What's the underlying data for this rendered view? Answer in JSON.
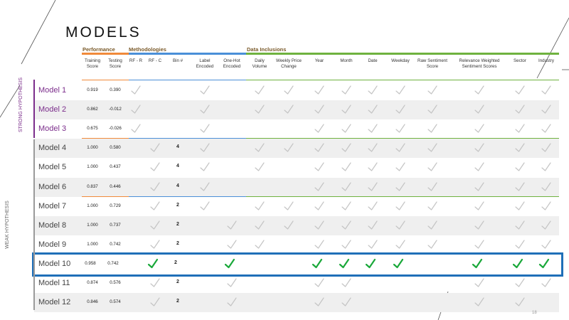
{
  "title": "MODELS",
  "groups": {
    "performance": "Performance",
    "methodologies": "Methodologies",
    "data_inclusions": "Data Inclusions"
  },
  "side_labels": {
    "strong": "STRONG HYPOTHESIS",
    "weak": "WEAK HYPOTHESIS"
  },
  "columns": [
    {
      "key": "train",
      "label": "Training Score"
    },
    {
      "key": "test",
      "label": "Testing Score"
    },
    {
      "key": "rfr",
      "label": "RF - R"
    },
    {
      "key": "rfc",
      "label": "RF - C"
    },
    {
      "key": "bin",
      "label": "Bin #"
    },
    {
      "key": "label_enc",
      "label": "Label Encoded"
    },
    {
      "key": "onehot",
      "label": "One-Hot Encoded"
    },
    {
      "key": "daily_vol",
      "label": "Daily Volume"
    },
    {
      "key": "weekly_price",
      "label": "Weekly Price Change"
    },
    {
      "key": "year",
      "label": "Year"
    },
    {
      "key": "month",
      "label": "Month"
    },
    {
      "key": "date",
      "label": "Date"
    },
    {
      "key": "weekday",
      "label": "Weekday"
    },
    {
      "key": "raw_sent",
      "label": "Raw Sentiment Score"
    },
    {
      "key": "rel_sent",
      "label": "Relevance Weighted Sentiment Scores"
    },
    {
      "key": "sector",
      "label": "Sector"
    },
    {
      "key": "industry",
      "label": "Industry"
    }
  ],
  "rows": [
    {
      "name": "Model 1",
      "train": "0.919",
      "test": "0.390",
      "bin": "",
      "checks": [
        "rfr",
        "label_enc",
        "daily_vol",
        "weekly_price",
        "year",
        "month",
        "date",
        "weekday",
        "raw_sent",
        "rel_sent",
        "sector",
        "industry"
      ]
    },
    {
      "name": "Model 2",
      "train": "0.862",
      "test": "-0.012",
      "bin": "",
      "checks": [
        "rfr",
        "label_enc",
        "daily_vol",
        "weekly_price",
        "year",
        "month",
        "date",
        "weekday",
        "raw_sent",
        "rel_sent",
        "sector",
        "industry"
      ]
    },
    {
      "name": "Model 3",
      "train": "0.675",
      "test": "-0.026",
      "bin": "",
      "checks": [
        "rfr",
        "label_enc",
        "year",
        "month",
        "date",
        "weekday",
        "raw_sent",
        "rel_sent",
        "sector",
        "industry"
      ]
    },
    {
      "name": "Model 4",
      "train": "1.000",
      "test": "0.580",
      "bin": "4",
      "checks": [
        "rfc",
        "label_enc",
        "daily_vol",
        "weekly_price",
        "year",
        "month",
        "date",
        "weekday",
        "raw_sent",
        "rel_sent",
        "sector",
        "industry"
      ]
    },
    {
      "name": "Model 5",
      "train": "1.000",
      "test": "0.437",
      "bin": "4",
      "checks": [
        "rfc",
        "label_enc",
        "daily_vol",
        "year",
        "month",
        "date",
        "weekday",
        "raw_sent",
        "rel_sent",
        "sector",
        "industry"
      ]
    },
    {
      "name": "Model 6",
      "train": "0.837",
      "test": "0.446",
      "bin": "4",
      "checks": [
        "rfc",
        "label_enc",
        "year",
        "month",
        "date",
        "weekday",
        "raw_sent",
        "rel_sent",
        "sector",
        "industry"
      ]
    },
    {
      "name": "Model 7",
      "train": "1.000",
      "test": "0.729",
      "bin": "2",
      "checks": [
        "rfc",
        "label_enc",
        "daily_vol",
        "weekly_price",
        "year",
        "month",
        "date",
        "weekday",
        "raw_sent",
        "rel_sent",
        "sector",
        "industry"
      ]
    },
    {
      "name": "Model 8",
      "train": "1.000",
      "test": "0.737",
      "bin": "2",
      "checks": [
        "rfc",
        "onehot",
        "daily_vol",
        "weekly_price",
        "year",
        "month",
        "date",
        "weekday",
        "raw_sent",
        "rel_sent",
        "sector",
        "industry"
      ]
    },
    {
      "name": "Model 9",
      "train": "1.000",
      "test": "0.742",
      "bin": "2",
      "checks": [
        "rfc",
        "onehot",
        "daily_vol",
        "year",
        "month",
        "date",
        "weekday",
        "raw_sent",
        "rel_sent",
        "sector",
        "industry"
      ]
    },
    {
      "name": "Model 10",
      "train": "0.958",
      "test": "0.742",
      "bin": "2",
      "highlight": true,
      "checks": [
        "rfc",
        "onehot",
        "year",
        "month",
        "date",
        "weekday",
        "rel_sent",
        "sector",
        "industry"
      ]
    },
    {
      "name": "Model 11",
      "train": "0.874",
      "test": "0.576",
      "bin": "2",
      "checks": [
        "rfc",
        "onehot",
        "year",
        "month",
        "rel_sent",
        "sector",
        "industry"
      ]
    },
    {
      "name": "Model 12",
      "train": "0.846",
      "test": "0.574",
      "bin": "2",
      "checks": [
        "rfc",
        "onehot",
        "year",
        "month",
        "rel_sent",
        "sector"
      ]
    }
  ],
  "page_number": "18",
  "colors": {
    "performance": "#f08a3a",
    "methodologies": "#4a8fd8",
    "data_inclusions": "#6fb23f",
    "strong": "#7b2d8b",
    "highlight_border": "#1f6fb8",
    "check_green": "#1aa83a",
    "check_gray": "#c4c4c4"
  }
}
